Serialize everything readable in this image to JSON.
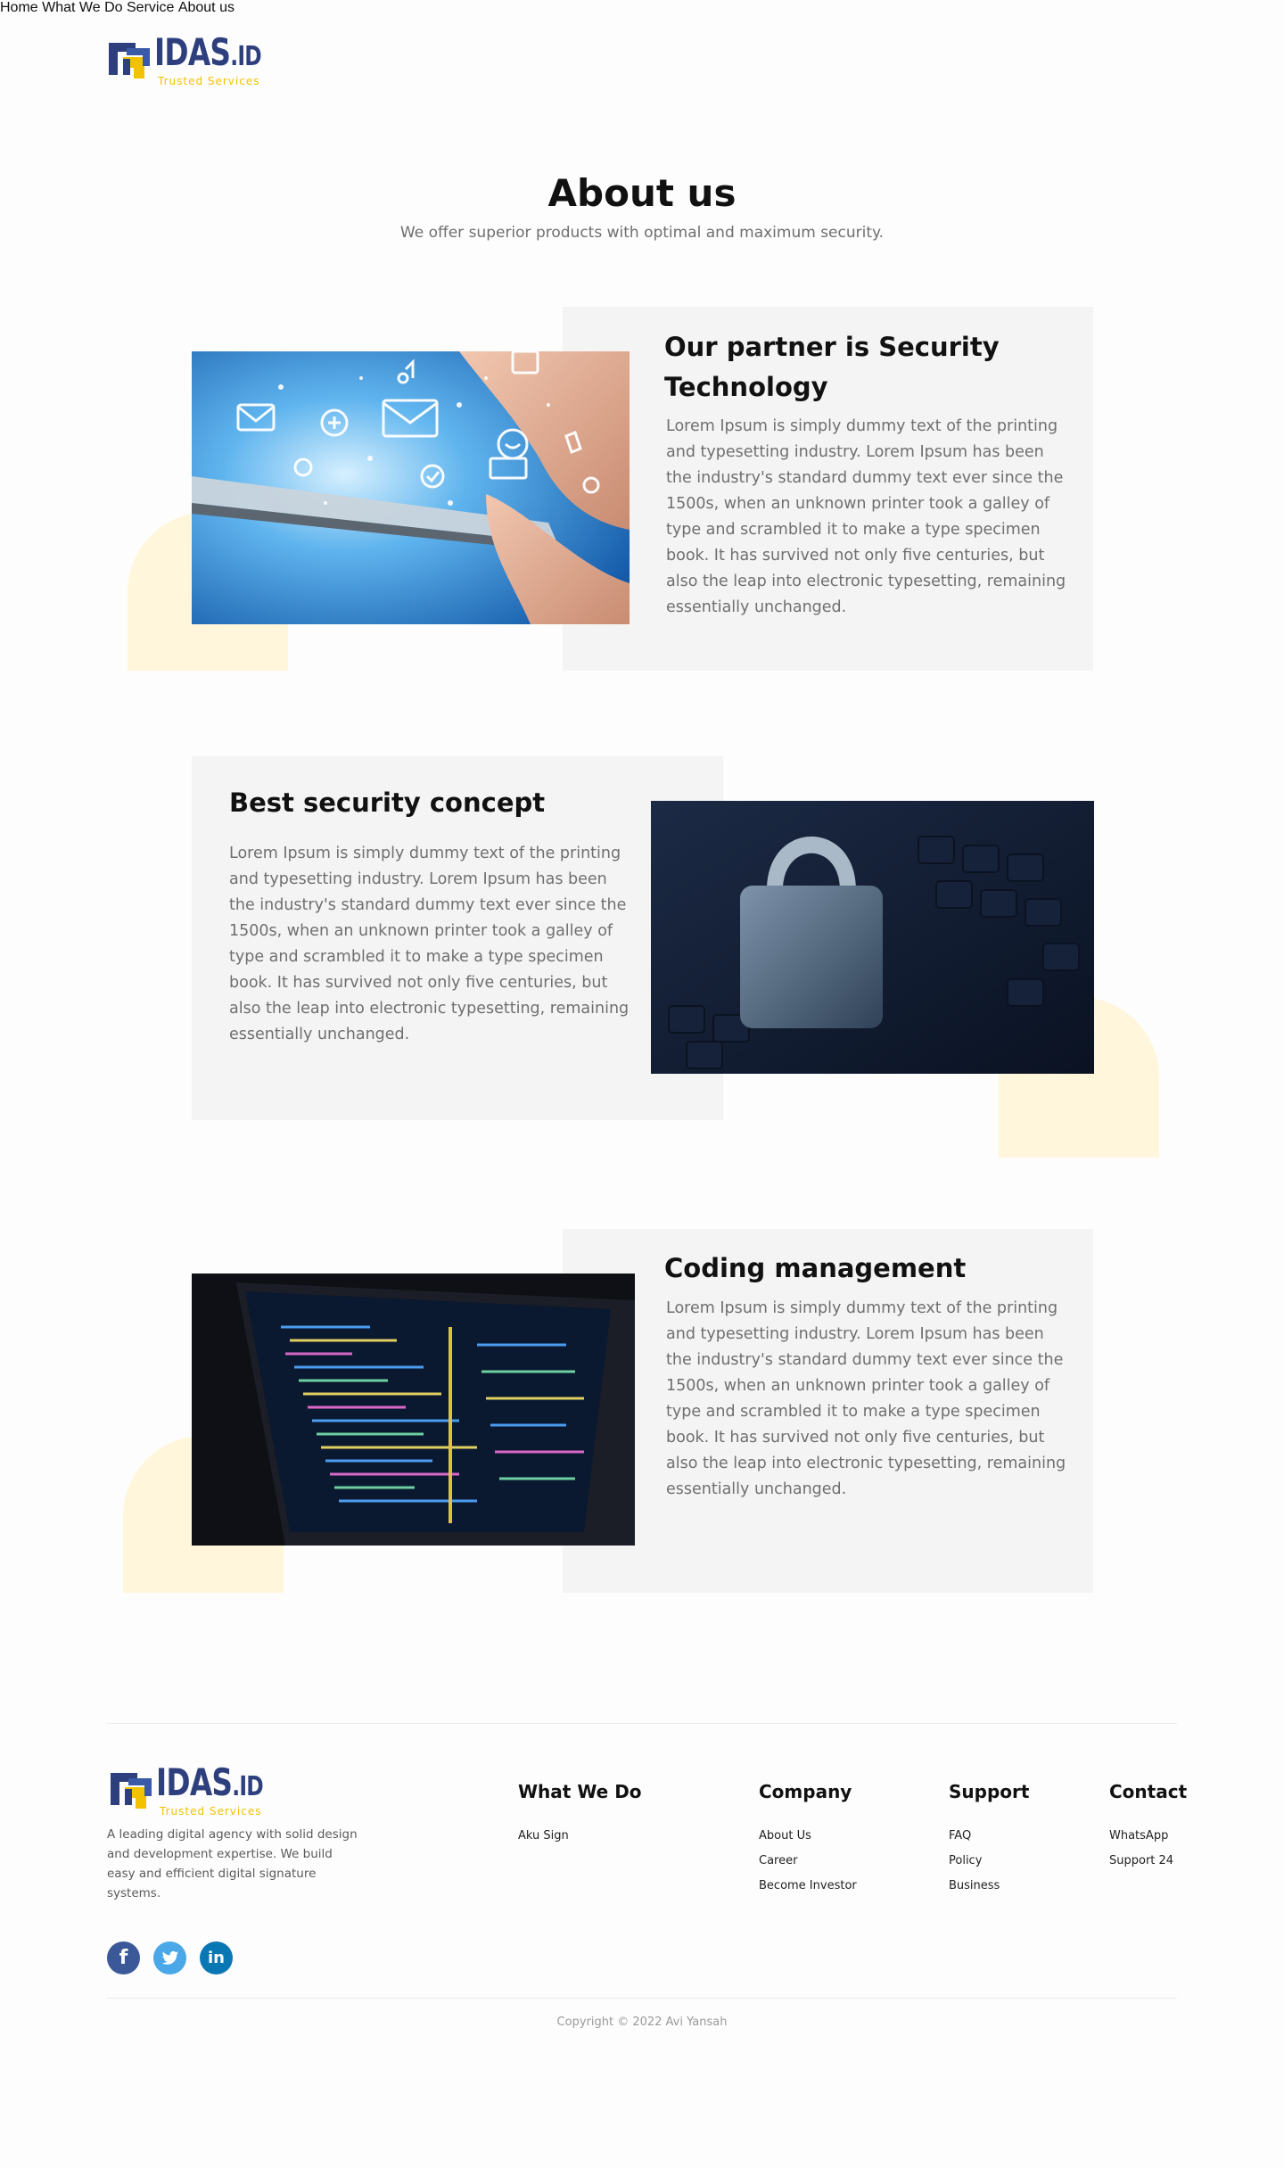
{
  "brand": {
    "name": "IDAS",
    "suffix": ".ID",
    "tagline": "Trusted Services"
  },
  "nav": {
    "items": [
      "Home",
      "What We Do",
      "Service",
      "About us"
    ]
  },
  "hero": {
    "title": "About us",
    "subtitle": "We offer superior products with optimal and maximum security."
  },
  "features": [
    {
      "title": "Our partner is Security Technology",
      "text": "Lorem Ipsum is simply dummy text of the printing and typesetting industry. Lorem Ipsum has been the industry's standard dummy text ever since the 1500s, when an unknown printer took a galley of type and scrambled it to make a type specimen book. It has survived not only five centuries, but also the leap into electronic typesetting, remaining essentially unchanged.",
      "image": "tablet-icons-photo"
    },
    {
      "title": "Best security concept",
      "text": "Lorem Ipsum is simply dummy text of the printing and typesetting industry. Lorem Ipsum has been the industry's standard dummy text ever since the 1500s, when an unknown printer took a galley of type and scrambled it to make a type specimen book. It has survived not only five centuries, but also the leap into electronic typesetting, remaining essentially unchanged.",
      "image": "padlock-keyboard-photo"
    },
    {
      "title": "Coding management",
      "text": "Lorem Ipsum is simply dummy text of the printing and typesetting industry. Lorem Ipsum has been the industry's standard dummy text ever since the 1500s, when an unknown printer took a galley of type and scrambled it to make a type specimen book. It has survived not only five centuries, but also the leap into electronic typesetting, remaining essentially unchanged.",
      "image": "laptop-code-photo"
    }
  ],
  "footer": {
    "description": "A leading digital agency with solid design and development expertise. We build easy and efficient digital signature systems.",
    "social": [
      "facebook-icon",
      "twitter-icon",
      "linkedin-icon"
    ],
    "columns": [
      {
        "title": "What We Do",
        "links": [
          "Aku Sign"
        ]
      },
      {
        "title": "Company",
        "links": [
          "About Us",
          "Career",
          "Become Investor"
        ]
      },
      {
        "title": "Support",
        "links": [
          "FAQ",
          "Policy",
          "Business"
        ]
      },
      {
        "title": "Contact",
        "links": [
          "WhatsApp",
          "Support 24"
        ]
      }
    ],
    "copyright": "Copyright © 2022 Avi Yansah"
  },
  "colors": {
    "brand_blue": "#2e3f7d",
    "brand_yellow": "#f2c200",
    "panel": "#f4f4f4",
    "blob": "#fff6dc",
    "facebook": "#3b5998",
    "twitter": "#4aa8e8",
    "linkedin": "#0a77b5"
  }
}
